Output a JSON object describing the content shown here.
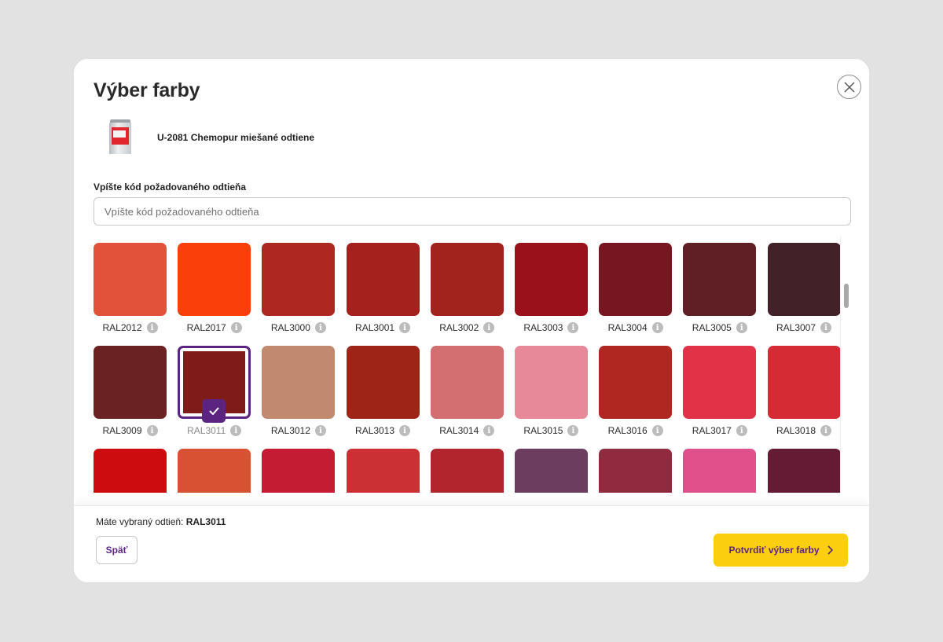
{
  "modal": {
    "title": "Výber farby",
    "close_icon": "close-icon"
  },
  "product": {
    "name": "U-2081 Chemopur miešané odtiene",
    "image_icon": "paint-can-icon"
  },
  "search": {
    "label": "Vpíšte kód požadovaného odtieňa",
    "placeholder": "Vpíšte kód požadovaného odtieňa",
    "value": ""
  },
  "swatches": [
    {
      "code": "RAL2012",
      "color": "#e2523b",
      "selected": false
    },
    {
      "code": "RAL2017",
      "color": "#fb3f08",
      "selected": false
    },
    {
      "code": "RAL3000",
      "color": "#ad2821",
      "selected": false
    },
    {
      "code": "RAL3001",
      "color": "#a5211e",
      "selected": false
    },
    {
      "code": "RAL3002",
      "color": "#a2221d",
      "selected": false
    },
    {
      "code": "RAL3003",
      "color": "#9b111b",
      "selected": false
    },
    {
      "code": "RAL3004",
      "color": "#771520",
      "selected": false
    },
    {
      "code": "RAL3005",
      "color": "#5e2025",
      "selected": false
    },
    {
      "code": "RAL3007",
      "color": "#432128",
      "selected": false
    },
    {
      "code": "RAL3009",
      "color": "#6a2223",
      "selected": false
    },
    {
      "code": "RAL3011",
      "color": "#7e1c1a",
      "selected": true
    },
    {
      "code": "RAL3012",
      "color": "#c18a6e",
      "selected": false
    },
    {
      "code": "RAL3013",
      "color": "#9d2417",
      "selected": false
    },
    {
      "code": "RAL3014",
      "color": "#d36f71",
      "selected": false
    },
    {
      "code": "RAL3015",
      "color": "#e8899a",
      "selected": false
    },
    {
      "code": "RAL3016",
      "color": "#b02620",
      "selected": false
    },
    {
      "code": "RAL3017",
      "color": "#e13347",
      "selected": false
    },
    {
      "code": "RAL3018",
      "color": "#d42b35",
      "selected": false
    },
    {
      "code": "",
      "color": "#cc0c0e",
      "selected": false
    },
    {
      "code": "",
      "color": "#d95133",
      "selected": false
    },
    {
      "code": "",
      "color": "#c41d33",
      "selected": false
    },
    {
      "code": "",
      "color": "#cb3034",
      "selected": false
    },
    {
      "code": "",
      "color": "#b3252c",
      "selected": false
    },
    {
      "code": "",
      "color": "#6c3d5e",
      "selected": false
    },
    {
      "code": "",
      "color": "#8f2a3f",
      "selected": false
    },
    {
      "code": "",
      "color": "#e0508b",
      "selected": false
    },
    {
      "code": "",
      "color": "#651b33",
      "selected": false
    }
  ],
  "footer": {
    "selected_prefix": "Máte vybraný odtieň:",
    "selected_code": "RAL3011",
    "back_label": "Späť",
    "confirm_label": "Potvrdiť výber farby"
  },
  "colors": {
    "accent": "#5b2480",
    "confirm_bg": "#fccf0e"
  }
}
